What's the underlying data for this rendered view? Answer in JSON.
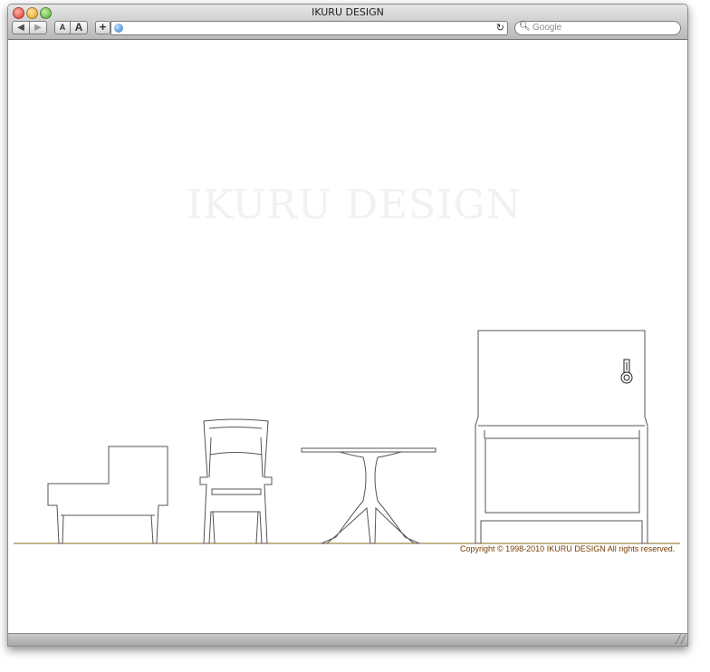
{
  "window": {
    "title": "IKURU DESIGN"
  },
  "toolbar": {
    "back_label": "◀",
    "forward_label": "▶",
    "font_small_label": "A",
    "font_large_label": "A",
    "add_bookmark_label": "+",
    "url_value": "",
    "reload_label": "↻",
    "search_placeholder": "Google"
  },
  "page": {
    "logo_text": "IKURU DESIGN",
    "copyright": "Copyright © 1998-2010 IKURU DESIGN All rights reserved."
  },
  "colors": {
    "line": "#555555",
    "ground": "#8b6914",
    "logo": "#f1f1f1",
    "copyright": "#7a3b00"
  }
}
